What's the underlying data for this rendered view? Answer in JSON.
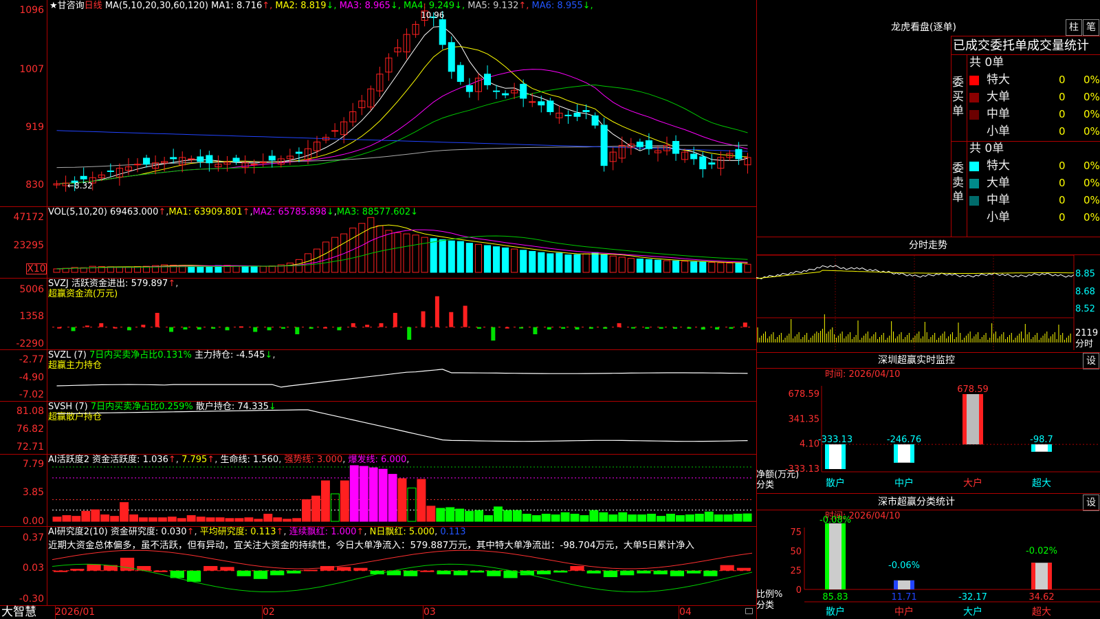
{
  "app_name": "大智慧",
  "stock": {
    "prefix": "★",
    "name": "甘咨询",
    "period": "日线"
  },
  "ma_line": {
    "label": "MA(5,10,20,30,60,120)",
    "items": [
      {
        "name": "MA1:",
        "value": "8.716",
        "arrow": "↑",
        "color": "#ffffff"
      },
      {
        "name": "MA2:",
        "value": "8.819",
        "arrow": "↓",
        "color": "#ffff00"
      },
      {
        "name": "MA3:",
        "value": "8.965",
        "arrow": "↓",
        "color": "#ff00ff"
      },
      {
        "name": "MA4:",
        "value": "9.249",
        "arrow": "↓",
        "color": "#00ff00"
      },
      {
        "name": "MA5:",
        "value": "9.132",
        "arrow": "↑",
        "color": "#cccccc"
      },
      {
        "name": "MA6:",
        "value": "8.955",
        "arrow": "↓",
        "color": "#2255ff"
      }
    ]
  },
  "price_axis": [
    "1096",
    "1007",
    "919",
    "830"
  ],
  "price_marks": {
    "high": "10.96",
    "low": "8.32"
  },
  "vol_line": {
    "label": "VOL(5,10,20)",
    "value": "69463.000",
    "arrow": "↑",
    "ma1": "MA1: 63909.801",
    "ma1_arrow": "↑",
    "ma2": "MA2: 65785.898",
    "ma2_arrow": "↓",
    "ma3": "MA3: 88577.602",
    "ma3_arrow": "↓"
  },
  "vol_axis": [
    "47172",
    "23295"
  ],
  "vol_unit": "X10",
  "svzj": {
    "label": "SVZJ",
    "title": "活跃资金进出:",
    "value": "579.897",
    "arrow": "↑",
    "sub": "超赢资金流(万元)",
    "axis": [
      "5006",
      "1358",
      "-2290"
    ]
  },
  "svzl": {
    "label": "SVZL (7)",
    "ratio": "7日内买卖净占比0.131%",
    "title": "主力持仓:",
    "value": "-4.545",
    "arrow": "↓",
    "sub": "超赢主力持仓",
    "axis": [
      "-2.77",
      "-4.90",
      "-7.02"
    ]
  },
  "svsh": {
    "label": "SVSH (7)",
    "ratio": "7日内买卖净占比0.259%",
    "title": "散户持仓:",
    "value": "74.335",
    "arrow": "↓",
    "sub": "超赢散户持仓",
    "axis": [
      "81.08",
      "76.82",
      "72.71"
    ]
  },
  "ai_act": {
    "label": "AI活跃度2",
    "t1": "资金活跃度:",
    "v1": "1.036",
    "v2": "7.795",
    "t3": "生命线:",
    "v3": "1.560",
    "t4": "强势线:",
    "v4": "3.000",
    "t5": "爆发线:",
    "v5": "6.000",
    "axis": [
      "7.79",
      "3.85",
      "0.00"
    ]
  },
  "ai_res": {
    "label": "AI研究度2(10)",
    "t1": "资金研究度:",
    "v1": "0.030",
    "t2": "平均研究度:",
    "v2": "0.113",
    "t3": "连续飘红:",
    "v3": "1.000",
    "t4": "N日飘红:",
    "v4": "5.000",
    "v5": "0.113",
    "comment": "近期大资金总体偏多，虽不活跃，但有异动，宜关注大资金的持续性，今日大单净流入：579.887万元，其中特大单净流出：-98.704万元，大单5日累计净入",
    "axis": [
      "0.37",
      "0.03",
      "-0.30"
    ]
  },
  "x_axis": [
    "2026/01",
    "02",
    "03",
    "04"
  ],
  "lhkp": {
    "title": "龙虎看盘(逐单)",
    "btn1": "柱",
    "btn2": "笔",
    "header": "已成交委托单成交量统计",
    "buy": {
      "side": "委买单",
      "total": "共 0单",
      "rows": [
        {
          "label": "特大",
          "count": "0",
          "pct": "0%",
          "color": "#ff0000"
        },
        {
          "label": "大单",
          "count": "0",
          "pct": "0%",
          "color": "#8b0000"
        },
        {
          "label": "中单",
          "count": "0",
          "pct": "0%",
          "color": "#6b0000"
        },
        {
          "label": "小单",
          "count": "0",
          "pct": "0%",
          "color": "#000000"
        }
      ]
    },
    "sell": {
      "side": "委卖单",
      "total": "共 0单",
      "rows": [
        {
          "label": "特大",
          "count": "0",
          "pct": "0%",
          "color": "#00ffff"
        },
        {
          "label": "大单",
          "count": "0",
          "pct": "0%",
          "color": "#008b8b"
        },
        {
          "label": "中单",
          "count": "0",
          "pct": "0%",
          "color": "#006b6b"
        },
        {
          "label": "小单",
          "count": "0",
          "pct": "0%",
          "color": "#000000"
        }
      ]
    }
  },
  "fenshi": {
    "title": "分时走势",
    "axis": [
      "8.85",
      "8.68",
      "8.52"
    ],
    "vol_axis": "2119",
    "vol_unit": "分时"
  },
  "monitor": {
    "title": "深圳超赢实时监控",
    "btn": "设",
    "time": "时间: 2026/04/10",
    "axis": [
      "678.59",
      "341.35",
      "4.10",
      "-333.13"
    ],
    "legend1": "净额(万元)",
    "legend2": "分类",
    "categories": [
      "散户",
      "中户",
      "大户",
      "超大"
    ],
    "labels": [
      "-333.13",
      "-246.76",
      "678.59",
      "-98.7"
    ]
  },
  "classify": {
    "title": "深市超赢分类统计",
    "btn": "设",
    "time": "时间: 2026/04/10",
    "axis": [
      "75",
      "50",
      "25",
      "0"
    ],
    "legend1": "比例%",
    "legend2": "分类",
    "categories": [
      "散户",
      "中户",
      "大户",
      "超大"
    ],
    "top_labels": [
      "-0.08%",
      "-0.06%",
      "-0.02%"
    ],
    "bottom_labels": [
      "85.83",
      "11.71",
      "-32.17",
      "34.62"
    ]
  },
  "chart_data": [
    {
      "type": "candlestick",
      "title": "甘咨询 日线",
      "x_range": [
        "2026/01",
        "2026/04/10"
      ],
      "ylim": [
        8.3,
        10.96
      ],
      "close": [
        8.33,
        8.34,
        8.35,
        8.4,
        8.42,
        8.46,
        8.52,
        8.56,
        8.58,
        8.62,
        8.62,
        8.64,
        8.66,
        8.7,
        8.72,
        8.7,
        8.66,
        8.64,
        8.62,
        8.65,
        8.66,
        8.64,
        8.62,
        8.65,
        8.68,
        8.7,
        8.74,
        8.78,
        8.85,
        8.95,
        9.02,
        9.12,
        9.25,
        9.4,
        9.56,
        9.74,
        9.96,
        10.2,
        10.35,
        10.55,
        10.7,
        10.9,
        10.8,
        10.4,
        10.0,
        9.85,
        9.7,
        9.9,
        9.8,
        9.7,
        9.65,
        9.72,
        9.6,
        9.55,
        9.5,
        9.4,
        9.38,
        9.35,
        9.33,
        9.4,
        9.2,
        8.6,
        8.8,
        8.9,
        8.92,
        8.88,
        8.85,
        8.82,
        8.9,
        8.78,
        8.8,
        8.7,
        8.55,
        8.62,
        8.72,
        8.78,
        8.7,
        8.72
      ],
      "high": 10.96,
      "low": 8.32
    },
    {
      "type": "bar",
      "title": "VOL(5,10,20)",
      "ylim": [
        0,
        47172
      ],
      "values": [
        3000,
        3500,
        4200,
        4000,
        5200,
        5000,
        4800,
        4500,
        4400,
        5000,
        5200,
        5800,
        6500,
        6200,
        6000,
        5500,
        5000,
        5200,
        5800,
        6000,
        5500,
        5000,
        4800,
        5100,
        5600,
        6500,
        8000,
        11000,
        16000,
        20000,
        26000,
        30000,
        33000,
        38000,
        42000,
        47000,
        40000,
        36000,
        34000,
        33000,
        32000,
        30000,
        29000,
        28000,
        27000,
        26500,
        25000,
        24000,
        23000,
        22000,
        21000,
        20000,
        19000,
        18000,
        17000,
        16000,
        16500,
        15000,
        15200,
        16000,
        17000,
        15000,
        14000,
        13000,
        12000,
        11500,
        11000,
        10500,
        10000,
        9800,
        9500,
        9000,
        8800,
        8500,
        8200,
        8000,
        7800,
        6946
      ]
    },
    {
      "type": "bar",
      "title": "SVZJ 活跃资金进出",
      "ylim": [
        -2290,
        5006
      ],
      "values": [
        0,
        -500,
        200,
        500,
        0,
        -400,
        300,
        1800,
        -600,
        -300,
        -300,
        -200,
        -400,
        100,
        -600,
        -400,
        -200,
        -900,
        -200,
        0,
        -400,
        500,
        300,
        500,
        1800,
        -1600,
        2000,
        3900,
        1900,
        2700,
        -200,
        -1700,
        0,
        -100,
        -900,
        -300,
        -200,
        -300,
        -200,
        -200,
        500,
        -100,
        -200,
        -200,
        -200,
        -200,
        -300,
        -300,
        -200,
        580
      ]
    },
    {
      "type": "line",
      "title": "SVZL 主力持仓",
      "ylim": [
        -7.02,
        -2.77
      ],
      "value": -4.545
    },
    {
      "type": "line",
      "title": "SVSH 散户持仓",
      "ylim": [
        72.71,
        81.08
      ],
      "value": 74.335
    },
    {
      "type": "bar",
      "title": "AI活跃度2",
      "ylim": [
        0,
        7.79
      ],
      "values": [
        0.6,
        0.8,
        0.7,
        1.4,
        1.6,
        0.9,
        0.7,
        2.6,
        0.9,
        0.5,
        0.5,
        0.5,
        0.6,
        0.4,
        0.8,
        0.6,
        0.5,
        0.5,
        0.4,
        0.4,
        0.5,
        0.3,
        1.0,
        0.5,
        0.3,
        0.4,
        3.0,
        3.5,
        5.6,
        3.8,
        5.6,
        7.7,
        7.6,
        7.4,
        7.2,
        6.5,
        5.9,
        4.6,
        5.8,
        2.1,
        1.8,
        1.9,
        1.7,
        1.4,
        1.5,
        0.8,
        2.0,
        1.5,
        1.5,
        1.0,
        0.8,
        1.0,
        0.9,
        1.2,
        1.0,
        0.8,
        1.5,
        1.2,
        0.9,
        1.2,
        0.9,
        0.9,
        1.0,
        0.7,
        1.0,
        0.8,
        0.9,
        1.0,
        1.3,
        0.9,
        0.9,
        1.0,
        1.036
      ]
    },
    {
      "type": "bar",
      "title": "AI研究度2(10)",
      "ylim": [
        -0.3,
        0.37
      ],
      "values": [
        0.0,
        0.02,
        0.07,
        0.06,
        0.14,
        0.05,
        0.0,
        -0.08,
        -0.12,
        0.05,
        0.04,
        -0.06,
        -0.09,
        -0.05,
        -0.03,
        0.01,
        0.05,
        0.04,
        0.03,
        -0.04,
        -0.05,
        -0.06,
        0.0,
        -0.04,
        -0.05,
        -0.02,
        -0.06,
        -0.08,
        -0.05,
        -0.04,
        -0.02,
        0.05,
        -0.03,
        -0.07,
        -0.05,
        -0.03,
        -0.04,
        -0.06,
        -0.03,
        -0.06,
        0.06,
        0.03
      ]
    },
    {
      "type": "bar",
      "title": "深圳超赢实时监控",
      "categories": [
        "散户",
        "中户",
        "大户",
        "超大"
      ],
      "values": [
        -333.13,
        -246.76,
        678.59,
        -98.7
      ],
      "ylim": [
        -333.13,
        678.59
      ]
    },
    {
      "type": "bar",
      "title": "深市超赢分类统计",
      "categories": [
        "散户",
        "中户",
        "大户",
        "超大"
      ],
      "values": [
        85.83,
        11.71,
        -32.17,
        34.62
      ],
      "ylim": [
        0,
        75
      ]
    }
  ]
}
